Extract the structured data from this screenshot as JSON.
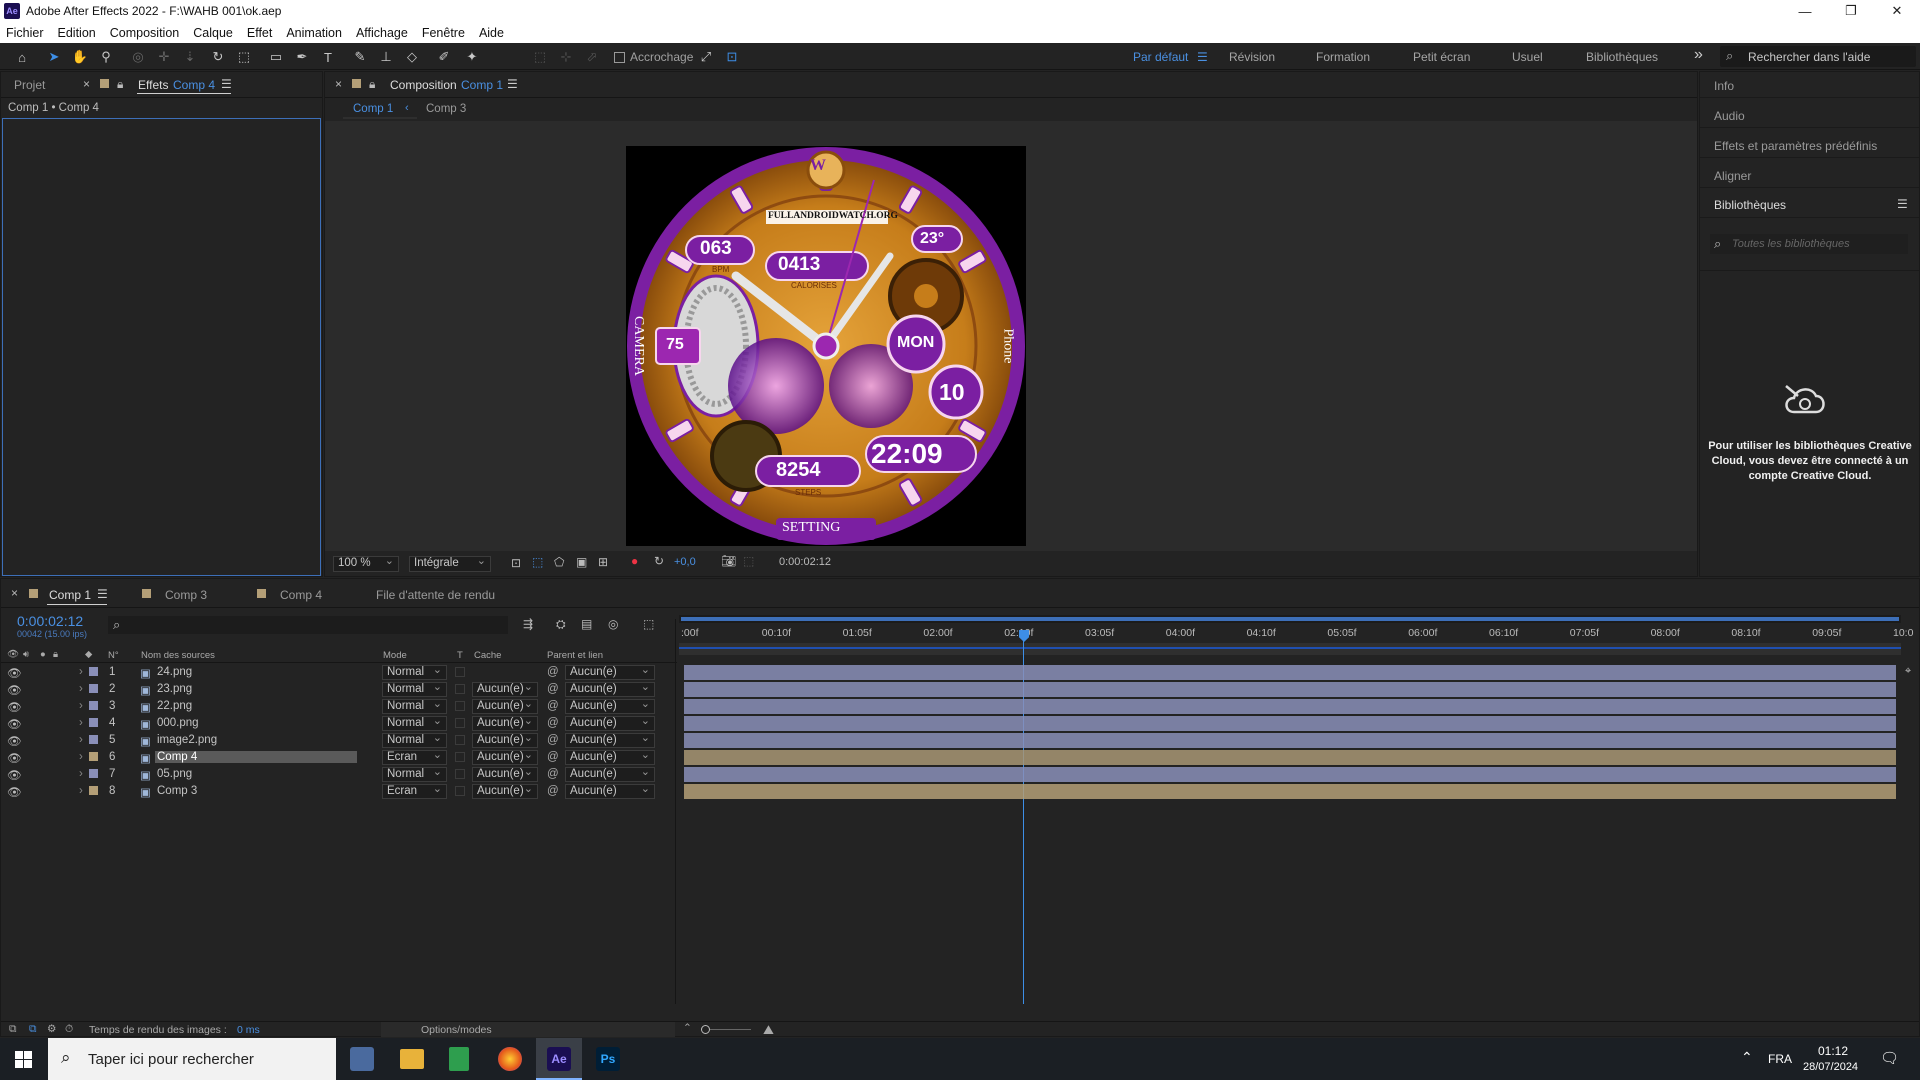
{
  "window": {
    "title": "Adobe After Effects 2022 - F:\\WAHB 001\\ok.aep",
    "app_badge": "Ae",
    "minimize": "—",
    "restore": "❐",
    "close": "✕"
  },
  "menu": [
    "Fichier",
    "Edition",
    "Composition",
    "Calque",
    "Effet",
    "Animation",
    "Affichage",
    "Fenêtre",
    "Aide"
  ],
  "toolbar": {
    "snap_label": "Accrochage",
    "workspaces": [
      "Par défaut",
      "Révision",
      "Formation",
      "Petit écran",
      "Usuel",
      "Bibliothèques"
    ],
    "active_workspace": "Par défaut",
    "overflow": "»",
    "search_placeholder": "Rechercher dans l'aide"
  },
  "left_panel": {
    "tab_project": "Projet",
    "tab_effects": "Effets",
    "tab_effects_comp": "Comp 4",
    "breadcrumb": "Comp 1 • Comp 4"
  },
  "comp_panel": {
    "label": "Composition",
    "comp_name": "Comp 1",
    "sub_tabs": [
      "Comp 1",
      "Comp 3"
    ],
    "zoom": "100 %",
    "resolution": "Intégrale",
    "exposure": "+0,0",
    "timecode": "0:00:02:12"
  },
  "watch": {
    "top_text": "FULLANDROIDWATCH.ORG",
    "bpm": "063",
    "bpm_label": "BPM",
    "calories": "0413",
    "calories_label": "CALORISES",
    "temp": "23°",
    "battery": "75",
    "day": "MON",
    "date": "10",
    "time": "22:09",
    "steps": "8254",
    "steps_label": "STEPS",
    "left_label": "CAMERA",
    "right_label": "Phone",
    "bottom_label": "SETTING",
    "logo": "W"
  },
  "right_panel": {
    "items": [
      "Info",
      "Audio",
      "Effets et paramètres prédéfinis",
      "Aligner"
    ],
    "libraries_title": "Bibliothèques",
    "libraries_search": "Toutes les bibliothèques",
    "message": "Pour utiliser les bibliothèques Creative Cloud, vous devez être connecté à un compte Creative Cloud."
  },
  "timeline": {
    "tabs": [
      "Comp 1",
      "Comp 3",
      "Comp 4",
      "File d'attente de rendu"
    ],
    "timecode": "0:00:02:12",
    "frames": "00042 (15.00 ips)",
    "search_icon": "⌕",
    "headers": {
      "num": "N°",
      "source": "Nom des sources",
      "mode": "Mode",
      "t": "T",
      "matte": "Cache",
      "parent": "Parent et lien"
    },
    "ruler": [
      ":00f",
      "00:10f",
      "01:05f",
      "02:00f",
      "02:10f",
      "03:05f",
      "04:00f",
      "04:10f",
      "05:05f",
      "06:00f",
      "06:10f",
      "07:05f",
      "08:00f",
      "08:10f",
      "09:05f",
      "10:0"
    ],
    "layers": [
      {
        "num": "1",
        "name": "24.png",
        "mode": "Normal",
        "matte": "",
        "parent": "Aucun(e)",
        "color": "#8a8fb8"
      },
      {
        "num": "2",
        "name": "23.png",
        "mode": "Normal",
        "matte": "Aucun(e)",
        "parent": "Aucun(e)",
        "color": "#8a8fb8"
      },
      {
        "num": "3",
        "name": "22.png",
        "mode": "Normal",
        "matte": "Aucun(e)",
        "parent": "Aucun(e)",
        "color": "#8a8fb8"
      },
      {
        "num": "4",
        "name": "000.png",
        "mode": "Normal",
        "matte": "Aucun(e)",
        "parent": "Aucun(e)",
        "color": "#8a8fb8"
      },
      {
        "num": "5",
        "name": "image2.png",
        "mode": "Normal",
        "matte": "Aucun(e)",
        "parent": "Aucun(e)",
        "color": "#8a8fb8"
      },
      {
        "num": "6",
        "name": "Comp 4",
        "mode": "Ecran",
        "matte": "Aucun(e)",
        "parent": "Aucun(e)",
        "color": "#b49f77"
      },
      {
        "num": "7",
        "name": "05.png",
        "mode": "Normal",
        "matte": "Aucun(e)",
        "parent": "Aucun(e)",
        "color": "#8a8fb8"
      },
      {
        "num": "8",
        "name": "Comp 3",
        "mode": "Ecran",
        "matte": "Aucun(e)",
        "parent": "Aucun(e)",
        "color": "#b49f77"
      }
    ],
    "render_time_label": "Temps de rendu des images :",
    "render_time_value": "0 ms",
    "options_modes": "Options/modes"
  },
  "taskbar": {
    "search_placeholder": "Taper ici pour rechercher",
    "language": "FRA",
    "time": "01:12",
    "date": "28/07/2024",
    "apps": [
      "Ae",
      "Ps"
    ]
  }
}
